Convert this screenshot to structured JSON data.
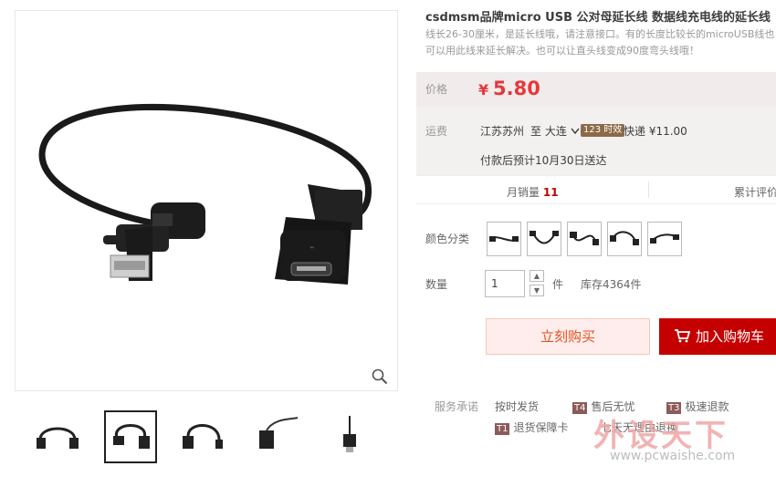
{
  "product": {
    "title": "csdmsm品牌micro USB 公对母延长线 数据线充电线的延长线",
    "description": "线长26-30厘米，是延长线哦，请注意接口。有的长度比较长的microUSB线也可以用此线来延长解决。也可以让直头线变成90度弯头线哦！"
  },
  "price": {
    "label": "价格",
    "currency": "¥",
    "value": "5.80"
  },
  "shipping": {
    "label": "运费",
    "from": "江苏苏州",
    "to": "至 大连",
    "badge": "123 时效",
    "method": "快递 ¥11.00",
    "eta": "付款后预计10月30日送达"
  },
  "sales": {
    "monthly_label": "月销量",
    "monthly_value": "11",
    "total_label": "累计评价"
  },
  "color": {
    "label": "颜色分类"
  },
  "quantity": {
    "label": "数量",
    "value": "1",
    "unit": "件",
    "stock": "库存4364件",
    "up": "▲",
    "down": "▼"
  },
  "buttons": {
    "buy": "立刻购买",
    "cart": "加入购物车"
  },
  "services": {
    "label": "服务承诺",
    "items": [
      {
        "tag": "",
        "text": "按时发货"
      },
      {
        "tag": "T4",
        "text": "售后无忧",
        "color": "#8c5a5a"
      },
      {
        "tag": "T3",
        "text": "极速退款",
        "color": "#8c5a5a"
      },
      {
        "tag": "T1",
        "text": "退货保障卡",
        "color": "#8c5a5a"
      },
      {
        "tag": "",
        "text": "七天无理由退换"
      }
    ]
  },
  "watermark": {
    "cn": "外设天下",
    "url": "www.pcwaishe.com"
  },
  "icons": {
    "zoom": "magnifier-icon",
    "cart": "cart-icon",
    "chevron": "chevron-down-icon"
  }
}
